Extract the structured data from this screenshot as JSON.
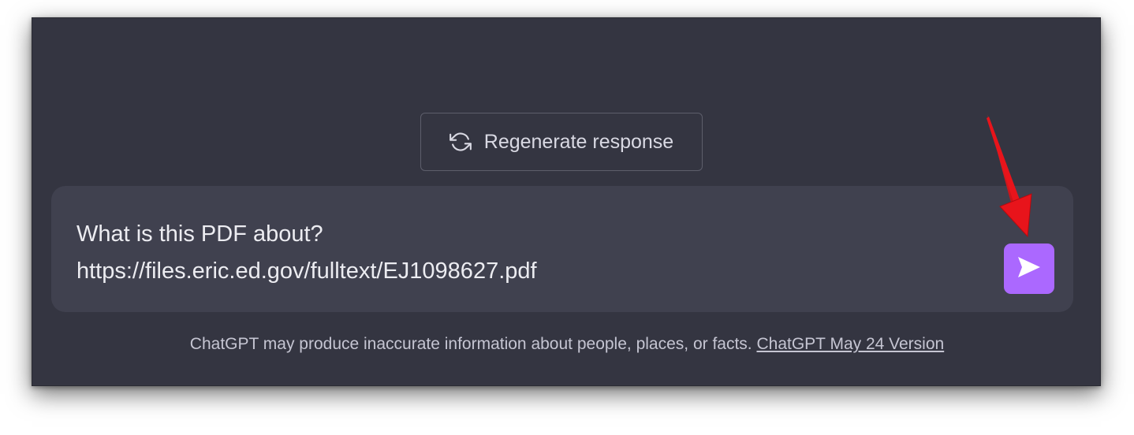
{
  "regenerate": {
    "label": "Regenerate response",
    "icon": "refresh-icon"
  },
  "composer": {
    "line1": "What is this PDF about?",
    "line2": "https://files.eric.ed.gov/fulltext/EJ1098627.pdf",
    "send_icon": "send-icon",
    "send_color": "#ab68ff"
  },
  "footer": {
    "disclaimer": "ChatGPT may produce inaccurate information about people, places, or facts. ",
    "version_link": "ChatGPT May 24 Version"
  },
  "colors": {
    "background": "#343541",
    "input_background": "#40414f",
    "annotation_arrow": "#e8141b"
  }
}
